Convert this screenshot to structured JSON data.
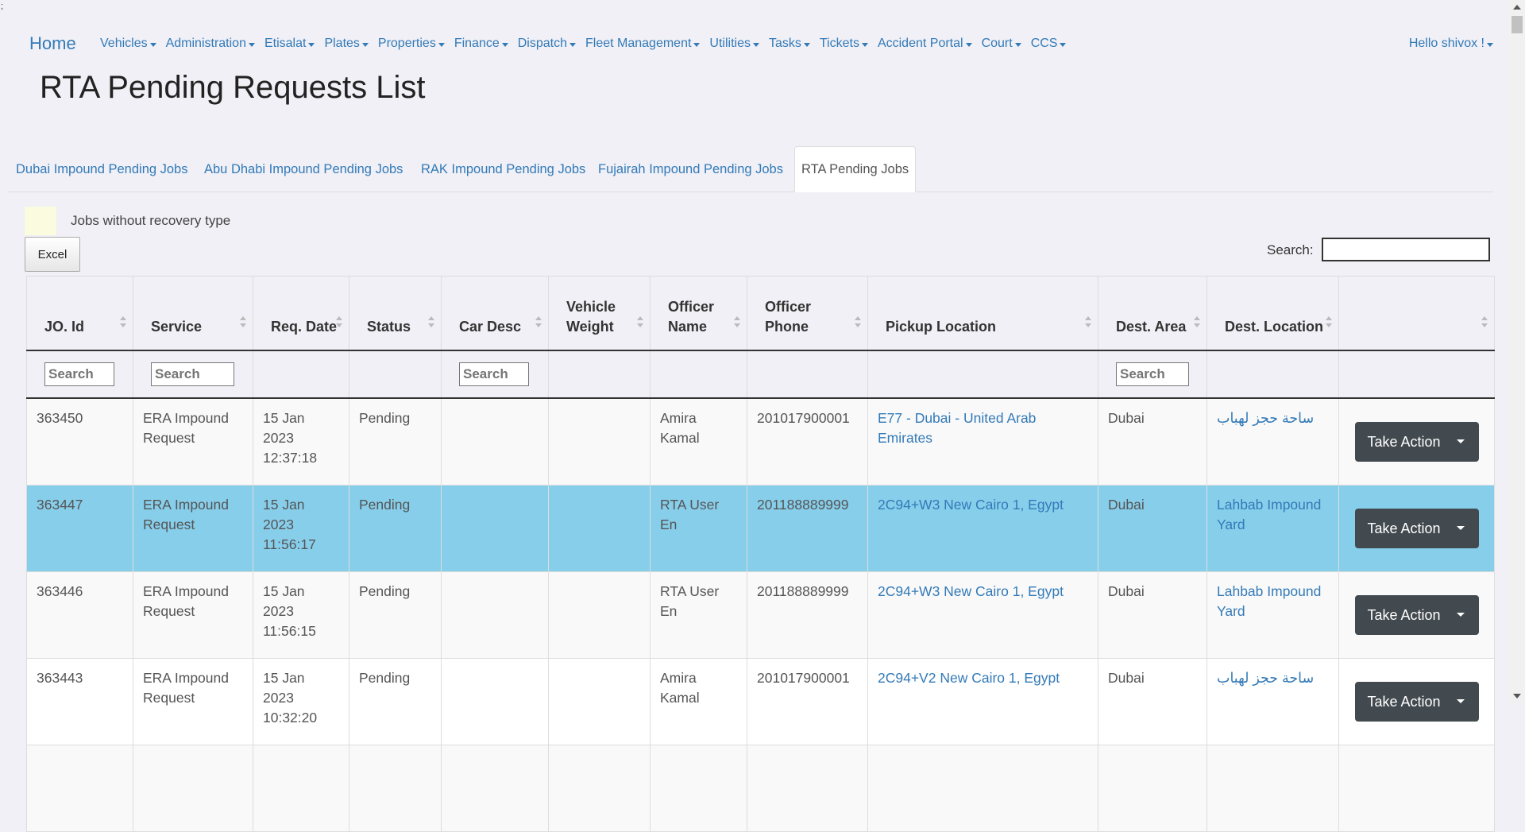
{
  "corner_mark": ";",
  "navbar": {
    "brand": "Home",
    "items": [
      "Vehicles",
      "Administration",
      "Etisalat",
      "Plates",
      "Properties",
      "Finance",
      "Dispatch",
      "Fleet Management",
      "Utilities",
      "Tasks",
      "Tickets",
      "Accident Portal",
      "Court",
      "CCS"
    ],
    "user": "Hello shivox !"
  },
  "page_title": "RTA Pending Requests List",
  "tabs": [
    "Dubai Impound Pending Jobs",
    "Abu Dhabi Impound Pending Jobs",
    "RAK Impound Pending Jobs",
    "Fujairah Impound Pending Jobs",
    "RTA Pending Jobs"
  ],
  "active_tab": "RTA Pending Jobs",
  "legend": {
    "text": "Jobs without recovery type",
    "color": "#fbfbdf"
  },
  "excel_label": "Excel",
  "search_label": "Search:",
  "table": {
    "headers": [
      "JO. Id",
      "Service",
      "Req. Date",
      "Status",
      "Car Desc",
      "Vehicle Weight",
      "Officer Name",
      "Officer Phone",
      "Pickup Location",
      "Dest. Area",
      "Dest. Location",
      ""
    ],
    "filter_placeholder": "Search",
    "rows": [
      {
        "id": "363450",
        "service": "ERA Impound Request",
        "date": "15 Jan 2023 12:37:18",
        "status": "Pending",
        "car_desc": "",
        "weight": "",
        "officer": "Amira Kamal",
        "phone": "201017900001",
        "pickup": "E77 - Dubai - United Arab Emirates",
        "area": "Dubai",
        "dest": "ساحة حجز لهباب",
        "action": "Take Action"
      },
      {
        "id": "363447",
        "service": "ERA Impound Request",
        "date": "15 Jan 2023 11:56:17",
        "status": "Pending",
        "car_desc": "",
        "weight": "",
        "officer": "RTA User En",
        "phone": "201188889999",
        "pickup": "2C94+W3 New Cairo 1, Egypt",
        "area": "Dubai",
        "dest": "Lahbab Impound Yard",
        "action": "Take Action"
      },
      {
        "id": "363446",
        "service": "ERA Impound Request",
        "date": "15 Jan 2023 11:56:15",
        "status": "Pending",
        "car_desc": "",
        "weight": "",
        "officer": "RTA User En",
        "phone": "201188889999",
        "pickup": "2C94+W3 New Cairo 1, Egypt",
        "area": "Dubai",
        "dest": "Lahbab Impound Yard",
        "action": "Take Action"
      },
      {
        "id": "363443",
        "service": "ERA Impound Request",
        "date": "15 Jan 2023 10:32:20",
        "status": "Pending",
        "car_desc": "",
        "weight": "",
        "officer": "Amira Kamal",
        "phone": "201017900001",
        "pickup": "2C94+V2 New Cairo 1, Egypt",
        "area": "Dubai",
        "dest": "ساحة حجز لهباب",
        "action": "Take Action"
      }
    ],
    "selected_row_color": "#87ceeb"
  },
  "colors": {
    "link": "#337ab7",
    "action_button": "#424a4f"
  }
}
